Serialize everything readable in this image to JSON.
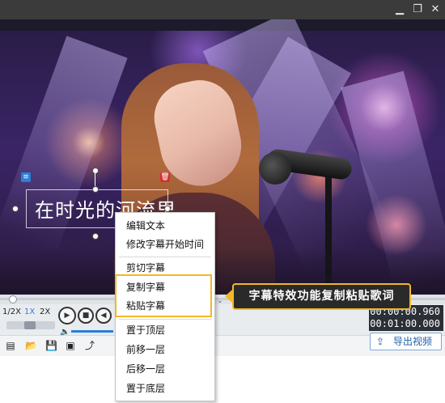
{
  "window": {
    "minimize_icon": "minimize-icon",
    "restore_icon": "restore-icon",
    "close_icon": "close-icon"
  },
  "caption": {
    "text": "在时光的河流里",
    "edit_icon": "list-icon",
    "delete_icon": "trash-icon"
  },
  "context_menu": {
    "items": [
      {
        "label": "编辑文本"
      },
      {
        "label": "修改字幕开始时间"
      },
      {
        "label": "剪切字幕"
      },
      {
        "label": "复制字幕"
      },
      {
        "label": "粘贴字幕"
      },
      {
        "label": "置于顶层"
      },
      {
        "label": "前移一层"
      },
      {
        "label": "后移一层"
      },
      {
        "label": "置于底层"
      }
    ]
  },
  "callout": {
    "text": "字幕特效功能复制粘贴歌词",
    "accent_color": "#f2b826"
  },
  "player": {
    "speeds": [
      "1/2X",
      "1X",
      "2X"
    ],
    "active_speed": "1X",
    "current_time": "00:00:00.960",
    "total_time": "00:01:00.000",
    "progress": 0.016
  },
  "toolbar": {
    "icons": [
      "subtitle-icon",
      "folder-open-icon",
      "save-icon",
      "save-as-icon",
      "share-icon"
    ],
    "export_label": "导出视频"
  }
}
